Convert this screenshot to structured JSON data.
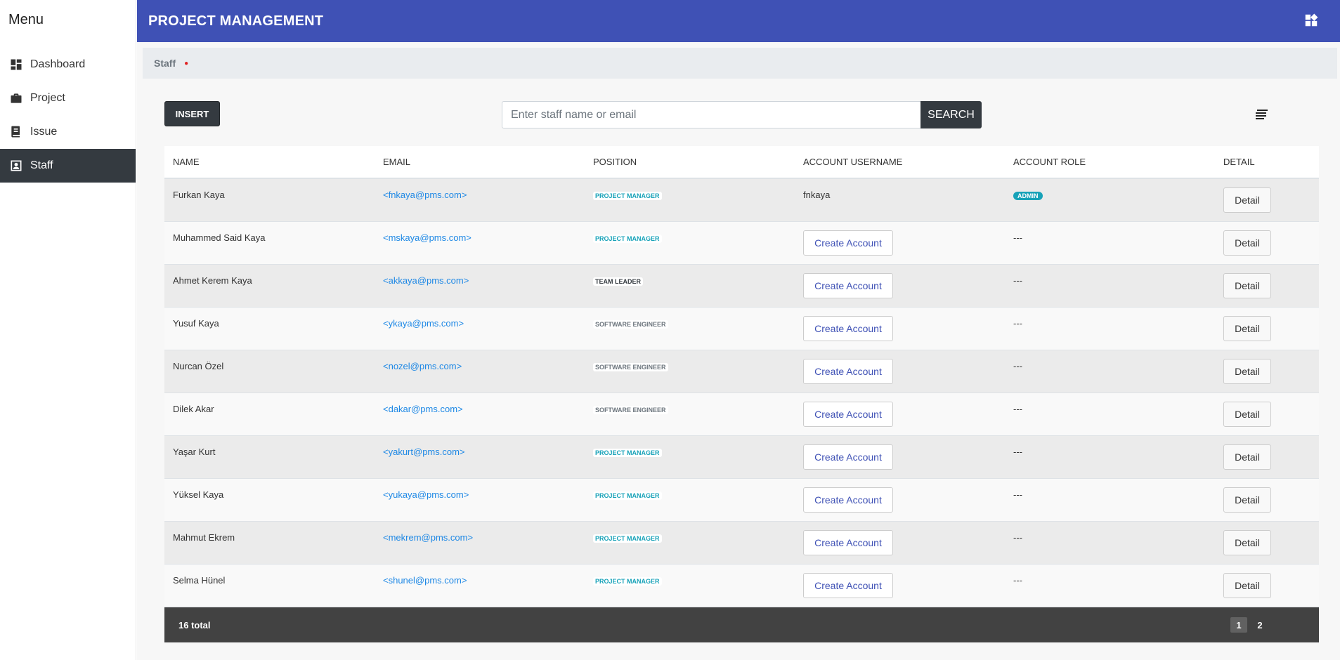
{
  "sidebar": {
    "title": "Menu",
    "items": [
      {
        "label": "Dashboard",
        "icon": "dashboard-icon"
      },
      {
        "label": "Project",
        "icon": "briefcase-icon"
      },
      {
        "label": "Issue",
        "icon": "issue-icon"
      },
      {
        "label": "Staff",
        "icon": "staff-icon",
        "active": true
      }
    ]
  },
  "header": {
    "title": "PROJECT MANAGEMENT",
    "icon": "widgets-icon"
  },
  "breadcrumb": {
    "current": "Staff"
  },
  "toolbar": {
    "insert_label": "INSERT",
    "search_placeholder": "Enter staff name or email",
    "search_label": "SEARCH",
    "filter_icon": "filter-list-icon"
  },
  "table": {
    "columns": [
      "NAME",
      "EMAIL",
      "POSITION",
      "ACCOUNT USERNAME",
      "ACCOUNT ROLE",
      "DETAIL"
    ],
    "rows": [
      {
        "name": "Furkan Kaya",
        "email": "<fnkaya@pms.com>",
        "position": "PROJECT MANAGER",
        "username": "fnkaya",
        "role": "ADMIN",
        "detail": "Detail"
      },
      {
        "name": "Muhammed Said Kaya",
        "email": "<mskaya@pms.com>",
        "position": "PROJECT MANAGER",
        "create": "Create Account",
        "role_text": "---",
        "detail": "Detail"
      },
      {
        "name": "Ahmet Kerem Kaya",
        "email": "<akkaya@pms.com>",
        "position": "TEAM LEADER",
        "create": "Create Account",
        "role_text": "---",
        "detail": "Detail"
      },
      {
        "name": "Yusuf Kaya",
        "email": "<ykaya@pms.com>",
        "position": "SOFTWARE ENGINEER",
        "create": "Create Account",
        "role_text": "---",
        "detail": "Detail"
      },
      {
        "name": "Nurcan Özel",
        "email": "<nozel@pms.com>",
        "position": "SOFTWARE ENGINEER",
        "create": "Create Account",
        "role_text": "---",
        "detail": "Detail"
      },
      {
        "name": "Dilek Akar",
        "email": "<dakar@pms.com>",
        "position": "SOFTWARE ENGINEER",
        "create": "Create Account",
        "role_text": "---",
        "detail": "Detail"
      },
      {
        "name": "Yaşar Kurt",
        "email": "<yakurt@pms.com>",
        "position": "PROJECT MANAGER",
        "create": "Create Account",
        "role_text": "---",
        "detail": "Detail"
      },
      {
        "name": "Yüksel Kaya",
        "email": "<yukaya@pms.com>",
        "position": "PROJECT MANAGER",
        "create": "Create Account",
        "role_text": "---",
        "detail": "Detail"
      },
      {
        "name": "Mahmut Ekrem",
        "email": "<mekrem@pms.com>",
        "position": "PROJECT MANAGER",
        "create": "Create Account",
        "role_text": "---",
        "detail": "Detail"
      },
      {
        "name": "Selma Hünel",
        "email": "<shunel@pms.com>",
        "position": "PROJECT MANAGER",
        "create": "Create Account",
        "role_text": "---",
        "detail": "Detail"
      }
    ]
  },
  "footer": {
    "total": "16 total",
    "pages": [
      "1",
      "2"
    ],
    "current_page": "1"
  },
  "colors": {
    "header": "#3f51b5",
    "dark": "#343a40",
    "link": "#1e88e5",
    "badge_info": "#17a2b8"
  }
}
